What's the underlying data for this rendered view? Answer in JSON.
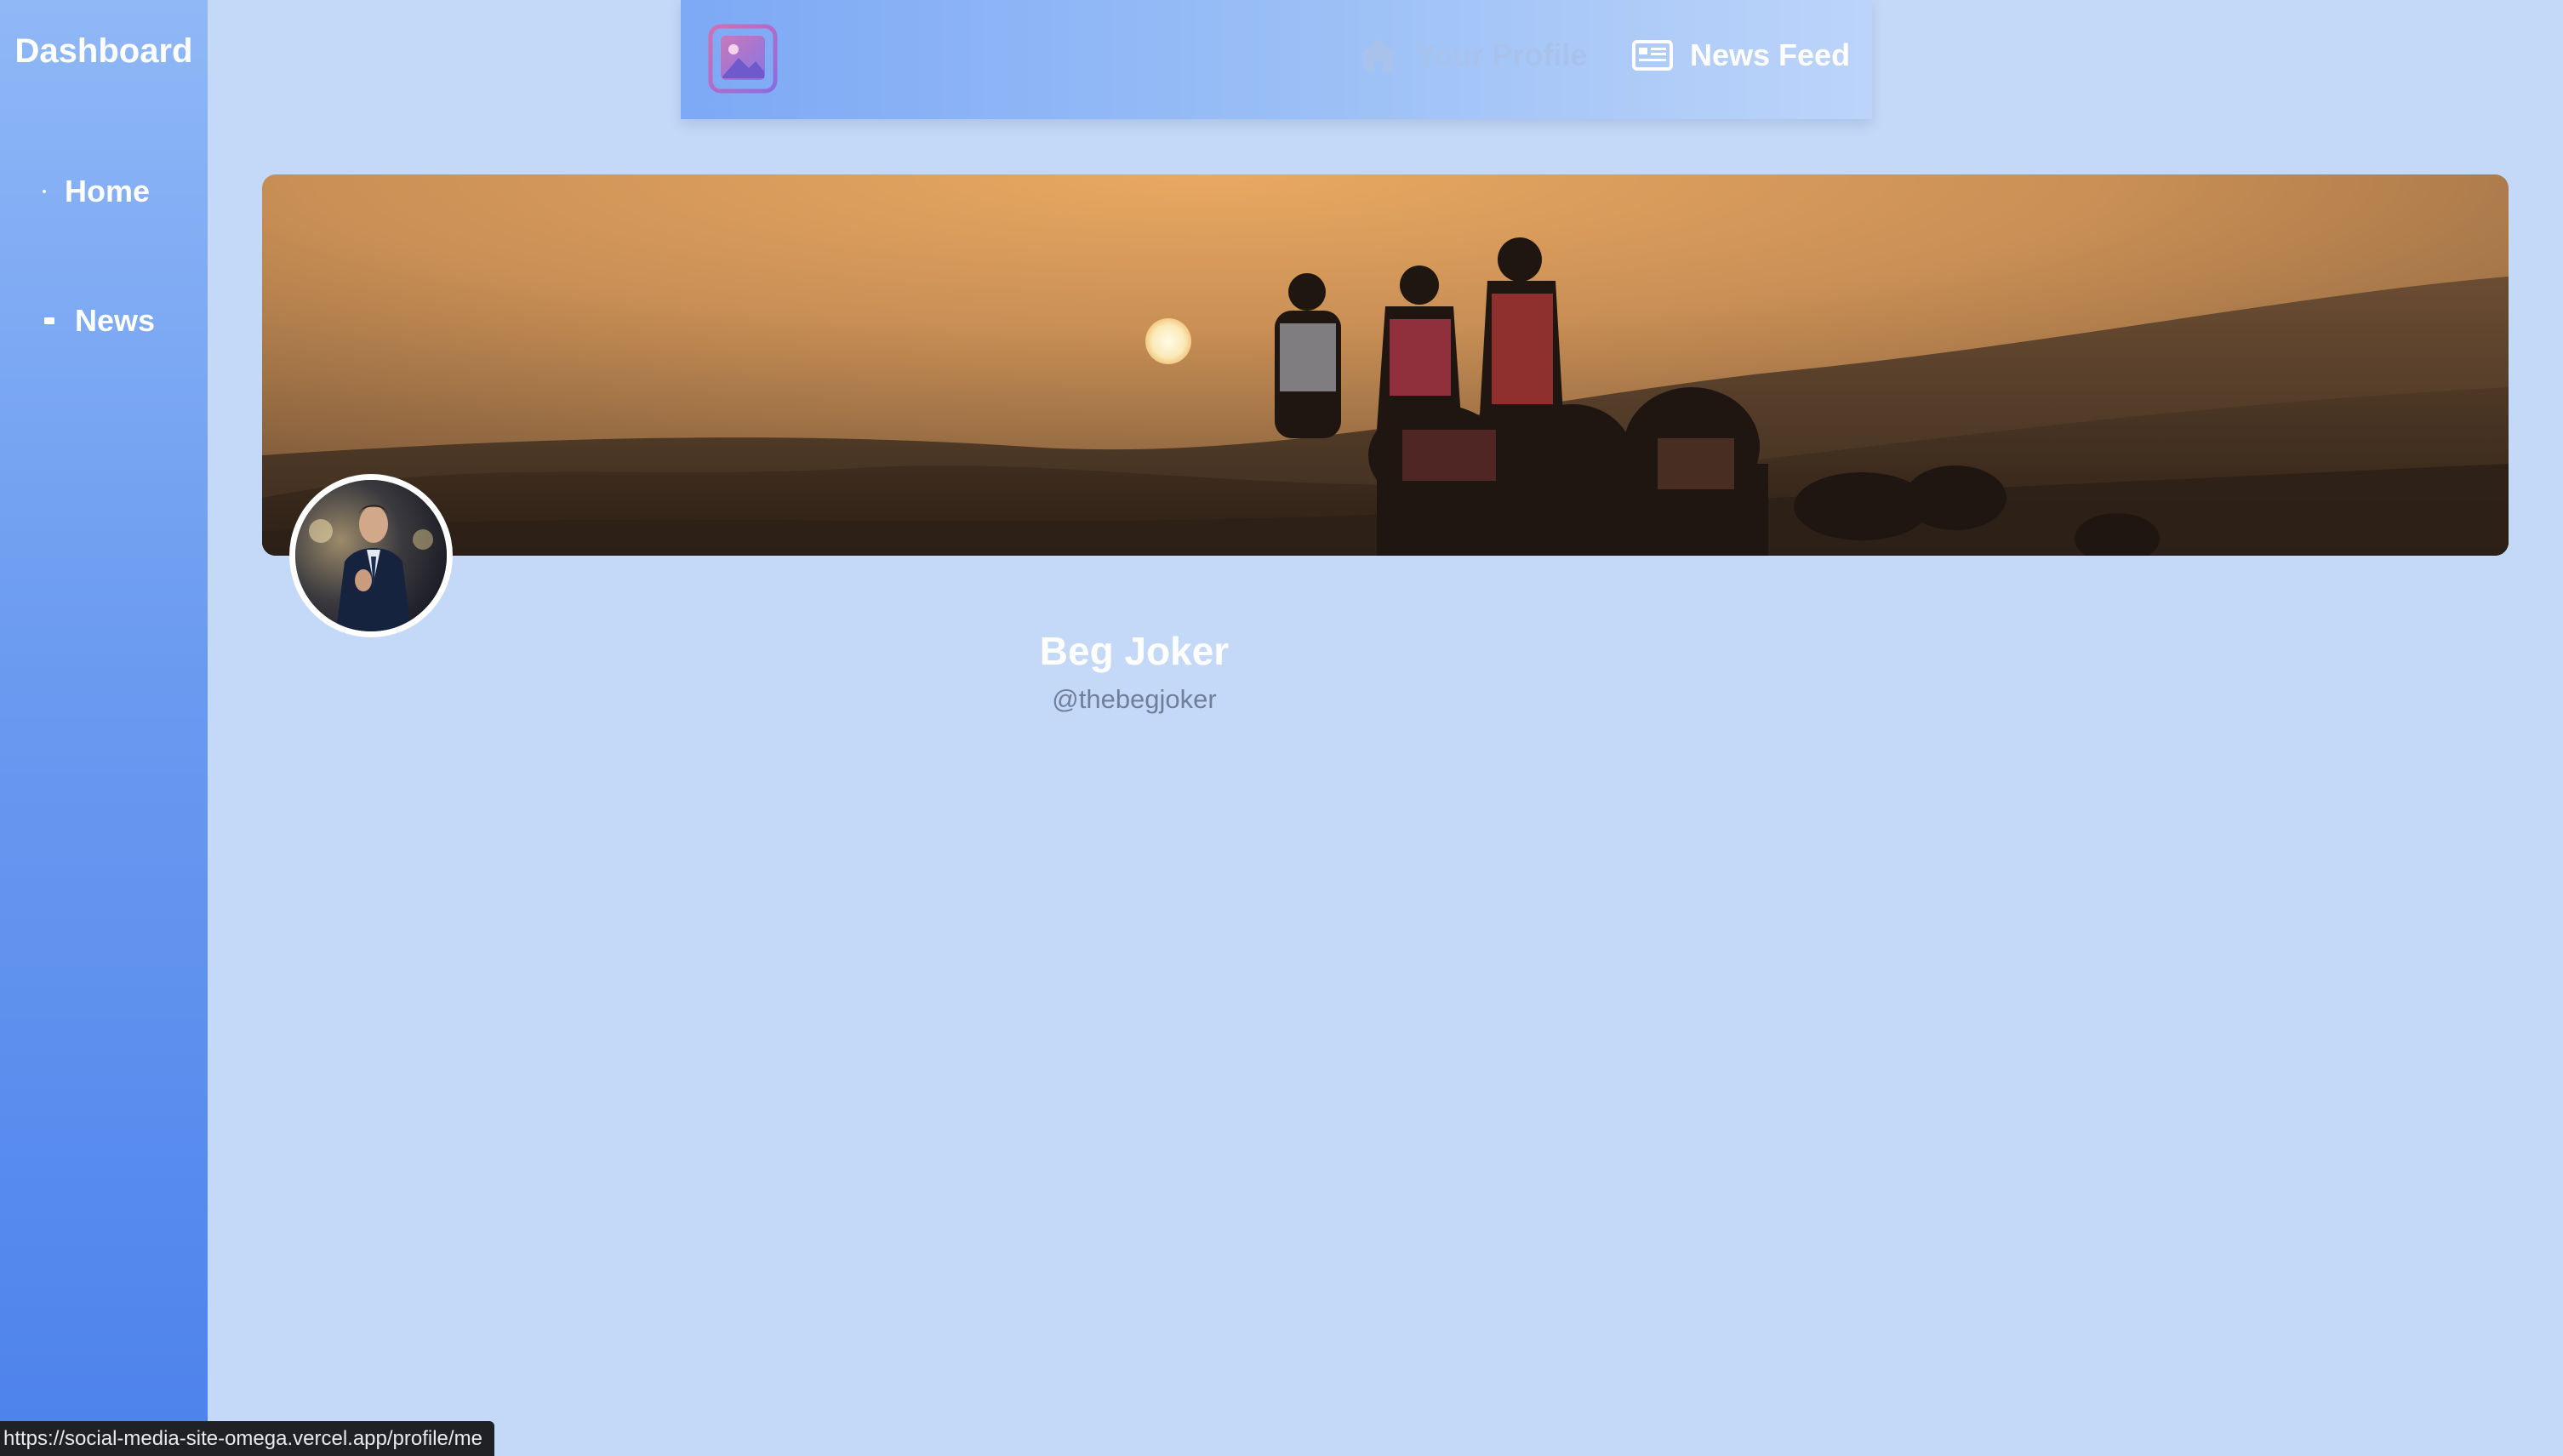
{
  "sidebar": {
    "title": "Dashboard",
    "items": [
      {
        "label": "Home"
      },
      {
        "label": "News"
      }
    ]
  },
  "topnav": {
    "logo_icon": "photo-gallery-icon",
    "links": [
      {
        "label": "Your Profile",
        "icon": "home-icon",
        "color": "#a9c2ec"
      },
      {
        "label": "News Feed",
        "icon": "newspaper-icon",
        "color": "#ffffff"
      }
    ]
  },
  "profile": {
    "name": "Beg Joker",
    "handle": "@thebegjoker"
  },
  "statusbar": {
    "url": "https://social-media-site-omega.vercel.app/profile/me"
  },
  "colors": {
    "background": "#c4d9f8",
    "sidebar_top": "#90b8f7",
    "sidebar_bottom": "#4d82ec",
    "accent": "#7da9f5"
  }
}
